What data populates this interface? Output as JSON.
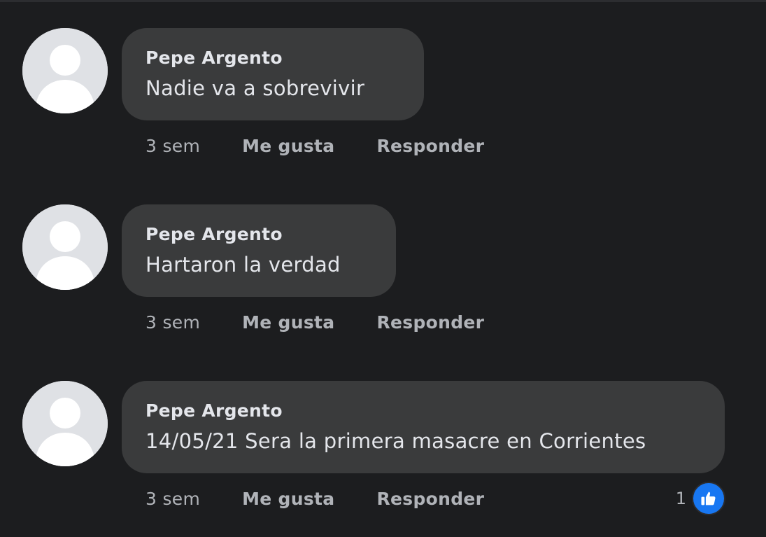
{
  "comments": [
    {
      "author": "Pepe Argento",
      "text": "Nadie va a sobrevivir",
      "time": "3 sem",
      "like_label": "Me gusta",
      "reply_label": "Responder"
    },
    {
      "author": "Pepe Argento",
      "text": "Hartaron la verdad",
      "time": "3 sem",
      "like_label": "Me gusta",
      "reply_label": "Responder"
    },
    {
      "author": "Pepe Argento",
      "text": "14/05/21 Sera la primera masacre en Corrientes",
      "time": "3 sem",
      "like_label": "Me gusta",
      "reply_label": "Responder",
      "reaction_count": "1",
      "reaction_icon": "thumbs-up-icon"
    }
  ],
  "colors": {
    "background": "#1c1d1f",
    "bubble": "#3a3b3c",
    "text": "#e4e6eb",
    "secondary_text": "#b0b3b8",
    "avatar_bg": "#dfe1e5",
    "like_blue": "#1877f2"
  }
}
